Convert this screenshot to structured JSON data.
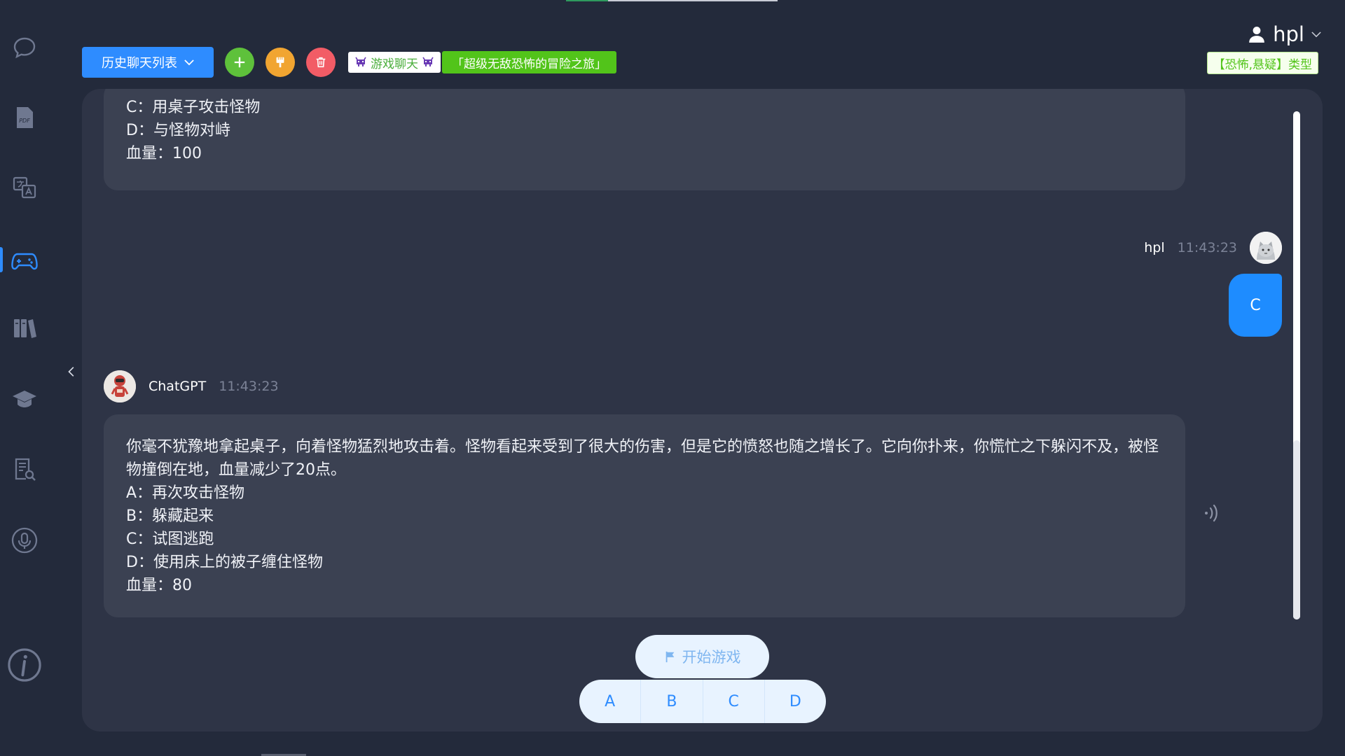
{
  "toolbar": {
    "history_label": "历史聊天列表",
    "game_tag": "游戏聊天",
    "story_title": "「超级无敌恐怖的冒险之旅」"
  },
  "user": {
    "name": "hpl",
    "type_tag": "【恐怖,悬疑】类型"
  },
  "messages": {
    "prev_bot": {
      "lines": [
        "C：用桌子攻击怪物",
        "D：与怪物对峙",
        "血量：100"
      ]
    },
    "user_msg": {
      "name": "hpl",
      "time": "11:43:23",
      "text": "C"
    },
    "bot_msg": {
      "name": "ChatGPT",
      "time": "11:43:23",
      "lines": [
        "你毫不犹豫地拿起桌子，向着怪物猛烈地攻击着。怪物看起来受到了很大的伤害，但是它的愤怒也随之增长了。它向你扑来，你慌忙之下躲闪不及，被怪",
        "物撞倒在地，血量减少了20点。",
        "A：再次攻击怪物",
        "B：躲藏起来",
        "C：试图逃跑",
        "D：使用床上的被子缠住怪物",
        "血量：80"
      ]
    }
  },
  "controls": {
    "start_label": "开始游戏",
    "choices": [
      "A",
      "B",
      "C",
      "D"
    ]
  },
  "colors": {
    "accent": "#2e8cff",
    "green": "#5ec13b",
    "orange": "#f1a531",
    "red": "#f25c66",
    "panel": "#2e3446",
    "bubble": "#3b4152"
  }
}
